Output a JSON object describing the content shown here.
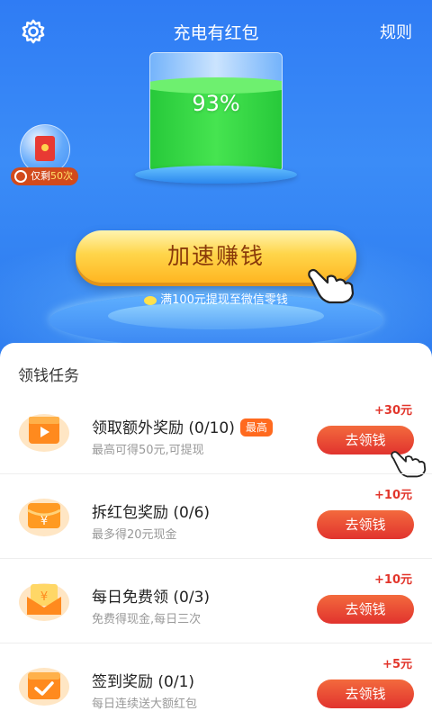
{
  "header": {
    "title": "充电有红包",
    "rules_label": "规则"
  },
  "battery": {
    "percent_label": "93%",
    "level": 0.93
  },
  "bubble": {
    "tag_prefix": "仅剩",
    "tag_count": "50次"
  },
  "main_button": {
    "label": "加速赚钱"
  },
  "withdraw_tip": "满100元提现至微信零钱",
  "tasks_panel": {
    "title": "领钱任务",
    "tasks": [
      {
        "name": "领取额外奖励 (0/10)",
        "badge": "最高",
        "sub": "最高可得50元,可提现",
        "reward": "+30元",
        "button": "去领钱",
        "icon": "video-icon"
      },
      {
        "name": "拆红包奖励 (0/6)",
        "sub": "最多得20元现金",
        "reward": "+10元",
        "button": "去领钱",
        "icon": "yuan-wallet-icon"
      },
      {
        "name": "每日免费领 (0/3)",
        "sub": "免费得现金,每日三次",
        "reward": "+10元",
        "button": "去领钱",
        "icon": "red-envelope-icon"
      },
      {
        "name": "签到奖励 (0/1)",
        "sub": "每日连续送大额红包",
        "reward": "+5元",
        "button": "去领钱",
        "icon": "checkin-calendar-icon"
      }
    ]
  },
  "colors": {
    "hero_blue": "#2f7cf4",
    "accent_red": "#e1332e",
    "gold": "#ffd54a"
  }
}
